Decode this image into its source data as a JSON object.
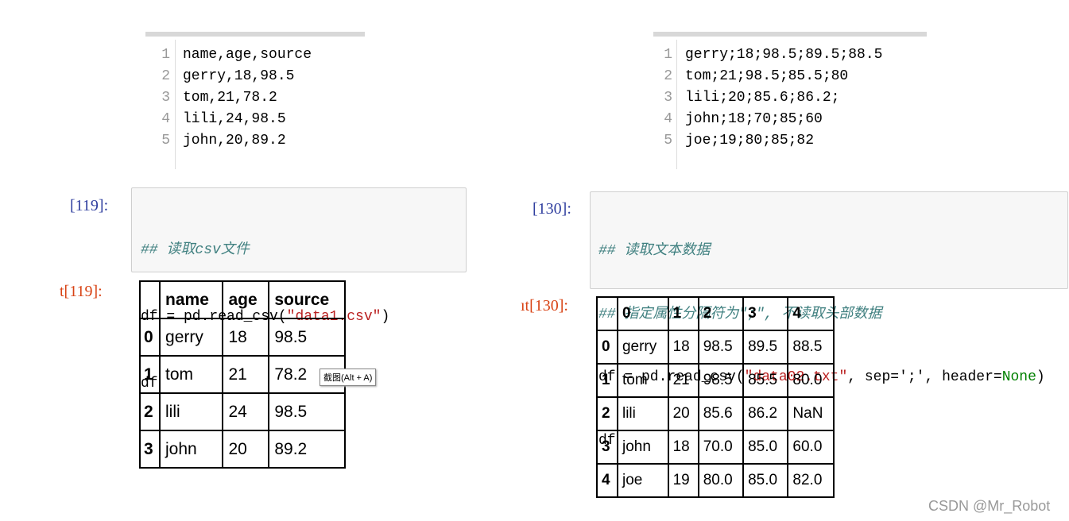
{
  "left": {
    "file_lines": [
      "name,age,source",
      "gerry,18,98.5",
      "tom,21,78.2",
      "lili,24,98.5",
      "john,20,89.2"
    ],
    "prompt": "[119]:",
    "code": {
      "comment": "## 读取csv文件",
      "l2_pre": "df = pd.read_csv(",
      "l2_str": "\"data1.csv\"",
      "l2_post": ")",
      "l3": "df"
    },
    "out_prompt": "t[119]:",
    "table": {
      "columns": [
        "",
        "name",
        "age",
        "source"
      ],
      "rows": [
        [
          "0",
          "gerry",
          "18",
          "98.5"
        ],
        [
          "1",
          "tom",
          "21",
          "78.2"
        ],
        [
          "2",
          "lili",
          "24",
          "98.5"
        ],
        [
          "3",
          "john",
          "20",
          "89.2"
        ]
      ]
    },
    "tooltip": "截图(Alt + A)"
  },
  "right": {
    "file_lines": [
      "gerry;18;98.5;89.5;88.5",
      "tom;21;98.5;85.5;80",
      "lili;20;85.6;86.2;",
      "john;18;70;85;60",
      "joe;19;80;85;82"
    ],
    "prompt": "[130]:",
    "code": {
      "c1": "## 读取文本数据",
      "c2": "## 指定属性分隔符为\";\", 不读取头部数据",
      "l3_pre": "df = pd.read_csv(",
      "l3_str": "\"data02.txt\"",
      "l3_mid": ", sep=';', header=",
      "l3_kw": "None",
      "l3_post": ")",
      "l4": "df"
    },
    "out_prompt": "ıt[130]:",
    "table": {
      "columns": [
        "",
        "0",
        "1",
        "2",
        "3",
        "4"
      ],
      "rows": [
        [
          "0",
          "gerry",
          "18",
          "98.5",
          "89.5",
          "88.5"
        ],
        [
          "1",
          "tom",
          "21",
          "98.5",
          "85.5",
          "80.0"
        ],
        [
          "2",
          "lili",
          "20",
          "85.6",
          "86.2",
          "NaN"
        ],
        [
          "3",
          "john",
          "18",
          "70.0",
          "85.0",
          "60.0"
        ],
        [
          "4",
          "joe",
          "19",
          "80.0",
          "85.0",
          "82.0"
        ]
      ]
    }
  },
  "watermark": "CSDN @Mr_Robot"
}
